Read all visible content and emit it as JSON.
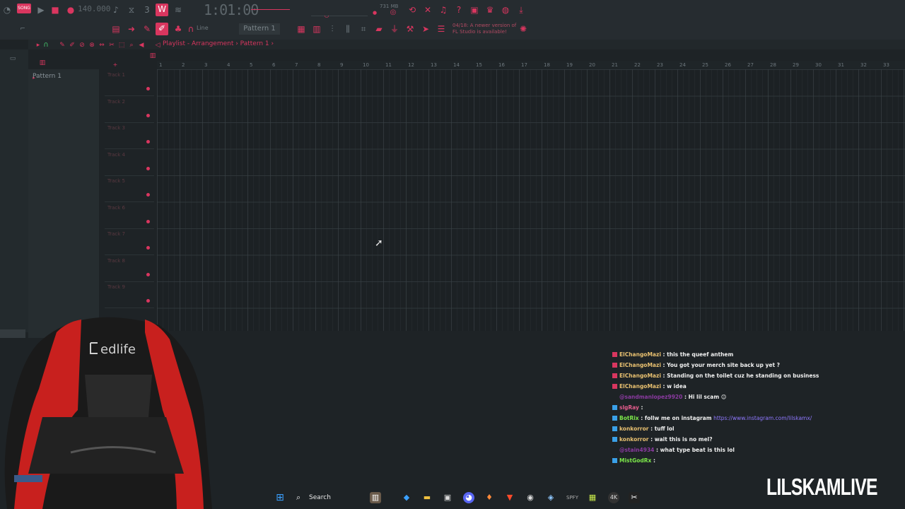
{
  "toolbar": {
    "mode_badge": "SONG",
    "tempo": "140.000",
    "time": "1:01:00",
    "memory": "731 MB",
    "snap": "Line",
    "pattern_select": "Pattern 1",
    "news": "04/18: A newer version of FL Studio is available!"
  },
  "playlist": {
    "breadcrumb": "Playlist - Arrangement › Pattern 1 ›",
    "browser_item": "Pattern 1",
    "tracks": [
      "Track 1",
      "Track 2",
      "Track 3",
      "Track 4",
      "Track 5",
      "Track 6",
      "Track 7",
      "Track 8",
      "Track 9"
    ],
    "ruler": [
      "1",
      "2",
      "3",
      "4",
      "5",
      "6",
      "7",
      "8",
      "9",
      "10",
      "11",
      "12",
      "13",
      "14",
      "15",
      "16",
      "17",
      "18",
      "19",
      "20",
      "21",
      "22",
      "23",
      "24",
      "25",
      "26",
      "27",
      "28",
      "29",
      "30",
      "31",
      "32",
      "33"
    ]
  },
  "chair_brand": "edlife",
  "chat": [
    {
      "user": "ElChangoMazi",
      "text": ": this the queef anthem",
      "user_color": "#e8c070",
      "icon": "#d9365f"
    },
    {
      "user": "ElChangoMazi",
      "text": ": You got your merch site back up yet ?",
      "user_color": "#e8c070",
      "icon": "#d9365f"
    },
    {
      "user": "ElChangoMazi",
      "text": ": Standing on the toilet cuz he standing on business",
      "user_color": "#e8c070",
      "icon": "#d9365f"
    },
    {
      "user": "ElChangoMazi",
      "text": ": w idea",
      "user_color": "#e8c070",
      "icon": "#d9365f"
    },
    {
      "user": "@sandmanlopez9920",
      "text": ": Hi lil scam 😊",
      "user_color": "#8a3aa0",
      "icon": ""
    },
    {
      "user": "slgRay",
      "text": ":",
      "user_color": "#e45c8c",
      "icon": "#3aa0e8"
    },
    {
      "user": "BotRix",
      "text": ": follw me on instagram",
      "link": "https://www.instagram.com/lilskamx/",
      "user_color": "#7ce84a",
      "icon": "#3aa0e8"
    },
    {
      "user": "konkorror",
      "text": ": tuff lol",
      "user_color": "#e8c070",
      "icon": "#3aa0e8"
    },
    {
      "user": "konkorror",
      "text": ": wait this is no mel?",
      "user_color": "#e8c070",
      "icon": "#3aa0e8"
    },
    {
      "user": "@stain4934",
      "text": ": what type beat is this lol",
      "user_color": "#8a3aa0",
      "icon": ""
    },
    {
      "user": "MistGodRx",
      "text": ":",
      "user_color": "#7ce84a",
      "icon": "#3aa0e8"
    }
  ],
  "taskbar": {
    "search": "Search"
  },
  "brand": "LILSKAMLIVE",
  "colors": {
    "accent": "#d9365f",
    "background": "#1e2326"
  }
}
